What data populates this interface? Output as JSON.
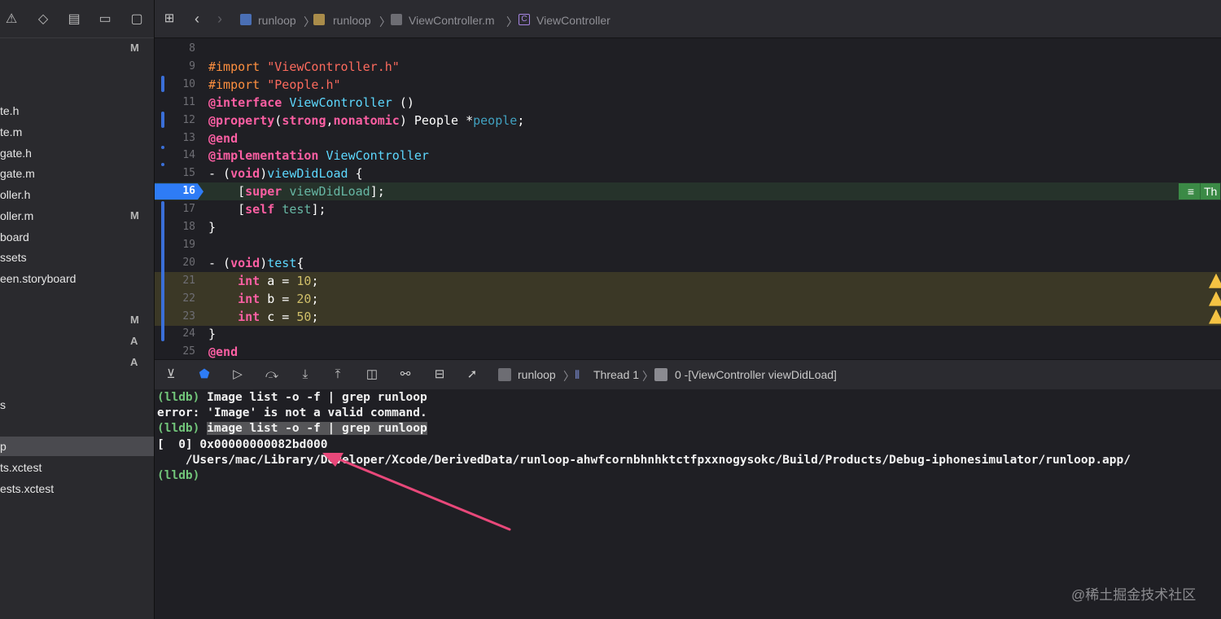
{
  "sidebar": {
    "files": [
      {
        "name": "",
        "badge": "M"
      },
      {
        "name": "",
        "badge": ""
      },
      {
        "name": "te.h",
        "badge": ""
      },
      {
        "name": "te.m",
        "badge": ""
      },
      {
        "name": "gate.h",
        "badge": ""
      },
      {
        "name": "gate.m",
        "badge": ""
      },
      {
        "name": "oller.h",
        "badge": ""
      },
      {
        "name": "oller.m",
        "badge": "M"
      },
      {
        "name": "board",
        "badge": ""
      },
      {
        "name": "ssets",
        "badge": ""
      },
      {
        "name": "een.storyboard",
        "badge": ""
      },
      {
        "name": "",
        "badge": ""
      },
      {
        "name": "",
        "badge": "M"
      },
      {
        "name": "",
        "badge": "A"
      },
      {
        "name": "",
        "badge": "A"
      },
      {
        "name": "",
        "badge": ""
      },
      {
        "name": "s",
        "badge": ""
      },
      {
        "name": "",
        "badge": ""
      },
      {
        "name": "p",
        "badge": ""
      },
      {
        "name": "ts.xctest",
        "badge": ""
      },
      {
        "name": "ests.xctest",
        "badge": ""
      }
    ]
  },
  "breadcrumb": {
    "project": "runloop",
    "folder": "runloop",
    "file": "ViewController.m",
    "symbol": "ViewController"
  },
  "editor": {
    "lines": [
      {
        "num": "8",
        "tokens": []
      },
      {
        "num": "9",
        "tokens": [
          {
            "t": "#import ",
            "c": "pp"
          },
          {
            "t": "\"ViewController.h\"",
            "c": "str"
          }
        ]
      },
      {
        "num": "10",
        "tokens": [
          {
            "t": "#import ",
            "c": "pp"
          },
          {
            "t": "\"People.h\"",
            "c": "str"
          }
        ]
      },
      {
        "num": "11",
        "tokens": [
          {
            "t": "@interface ",
            "c": "kw"
          },
          {
            "t": "ViewController",
            "c": "typ"
          },
          {
            "t": " ()",
            "c": "plain"
          }
        ]
      },
      {
        "num": "12",
        "tokens": [
          {
            "t": "@property",
            "c": "kw"
          },
          {
            "t": "(",
            "c": "plain"
          },
          {
            "t": "strong",
            "c": "kw"
          },
          {
            "t": ",",
            "c": "plain"
          },
          {
            "t": "nonatomic",
            "c": "kw"
          },
          {
            "t": ") People *",
            "c": "plain"
          },
          {
            "t": "people",
            "c": "prop"
          },
          {
            "t": ";",
            "c": "plain"
          }
        ]
      },
      {
        "num": "13",
        "tokens": [
          {
            "t": "@end",
            "c": "kw"
          }
        ]
      },
      {
        "num": "14",
        "tokens": [
          {
            "t": "@implementation ",
            "c": "kw"
          },
          {
            "t": "ViewController",
            "c": "typ"
          }
        ]
      },
      {
        "num": "15",
        "tokens": [
          {
            "t": "- (",
            "c": "plain"
          },
          {
            "t": "void",
            "c": "kw"
          },
          {
            "t": ")",
            "c": "plain"
          },
          {
            "t": "viewDidLoad",
            "c": "typ"
          },
          {
            "t": " {",
            "c": "plain"
          }
        ]
      },
      {
        "num": "16",
        "tokens": [
          {
            "t": "    [",
            "c": "plain"
          },
          {
            "t": "super",
            "c": "kw"
          },
          {
            "t": " ",
            "c": "plain"
          },
          {
            "t": "viewDidLoad",
            "c": "fn"
          },
          {
            "t": "];",
            "c": "plain"
          }
        ]
      },
      {
        "num": "17",
        "tokens": [
          {
            "t": "    [",
            "c": "plain"
          },
          {
            "t": "self",
            "c": "kw"
          },
          {
            "t": " ",
            "c": "plain"
          },
          {
            "t": "test",
            "c": "fn"
          },
          {
            "t": "];",
            "c": "plain"
          }
        ]
      },
      {
        "num": "18",
        "tokens": [
          {
            "t": "}",
            "c": "plain"
          }
        ]
      },
      {
        "num": "19",
        "tokens": []
      },
      {
        "num": "20",
        "tokens": [
          {
            "t": "- (",
            "c": "plain"
          },
          {
            "t": "void",
            "c": "kw"
          },
          {
            "t": ")",
            "c": "plain"
          },
          {
            "t": "test",
            "c": "typ"
          },
          {
            "t": "{",
            "c": "plain"
          }
        ]
      },
      {
        "num": "21",
        "tokens": [
          {
            "t": "    ",
            "c": "plain"
          },
          {
            "t": "int",
            "c": "kw"
          },
          {
            "t": " a = ",
            "c": "plain"
          },
          {
            "t": "10",
            "c": "num"
          },
          {
            "t": ";",
            "c": "plain"
          }
        ]
      },
      {
        "num": "22",
        "tokens": [
          {
            "t": "    ",
            "c": "plain"
          },
          {
            "t": "int",
            "c": "kw"
          },
          {
            "t": " b = ",
            "c": "plain"
          },
          {
            "t": "20",
            "c": "num"
          },
          {
            "t": ";",
            "c": "plain"
          }
        ]
      },
      {
        "num": "23",
        "tokens": [
          {
            "t": "    ",
            "c": "plain"
          },
          {
            "t": "int",
            "c": "kw"
          },
          {
            "t": " c = ",
            "c": "plain"
          },
          {
            "t": "50",
            "c": "num"
          },
          {
            "t": ";",
            "c": "plain"
          }
        ]
      },
      {
        "num": "24",
        "tokens": [
          {
            "t": "}",
            "c": "plain"
          }
        ]
      },
      {
        "num": "25",
        "tokens": [
          {
            "t": "@end",
            "c": "kw"
          }
        ]
      }
    ],
    "current_line_badge": "Th"
  },
  "debugbar": {
    "target": "runloop",
    "thread": "Thread 1",
    "frame": "0 -[ViewController viewDidLoad]"
  },
  "console": {
    "lines": [
      {
        "prompt": "(lldb)",
        "text": " Image list -o -f | grep runloop",
        "highlight": false
      },
      {
        "prompt": "",
        "text": "error: 'Image' is not a valid command.",
        "highlight": false
      },
      {
        "prompt": "(lldb)",
        "text": "image list -o -f | grep runloop",
        "highlight": true
      },
      {
        "prompt": "",
        "text": "[  0] 0x00000000082bd000",
        "highlight": false
      },
      {
        "prompt": "",
        "text": "    /Users/mac/Library/Developer/Xcode/DerivedData/runloop-ahwfcornbhnhktctfpxxnogysokc/Build/Products/Debug-iphonesimulator/runloop.app/",
        "highlight": false
      },
      {
        "prompt": "(lldb)",
        "text": "",
        "highlight": false
      }
    ]
  },
  "watermark": "@稀土掘金技术社区",
  "colors": {
    "accent": "#2e7cf6",
    "annotation_arrow": "#e8487a"
  }
}
